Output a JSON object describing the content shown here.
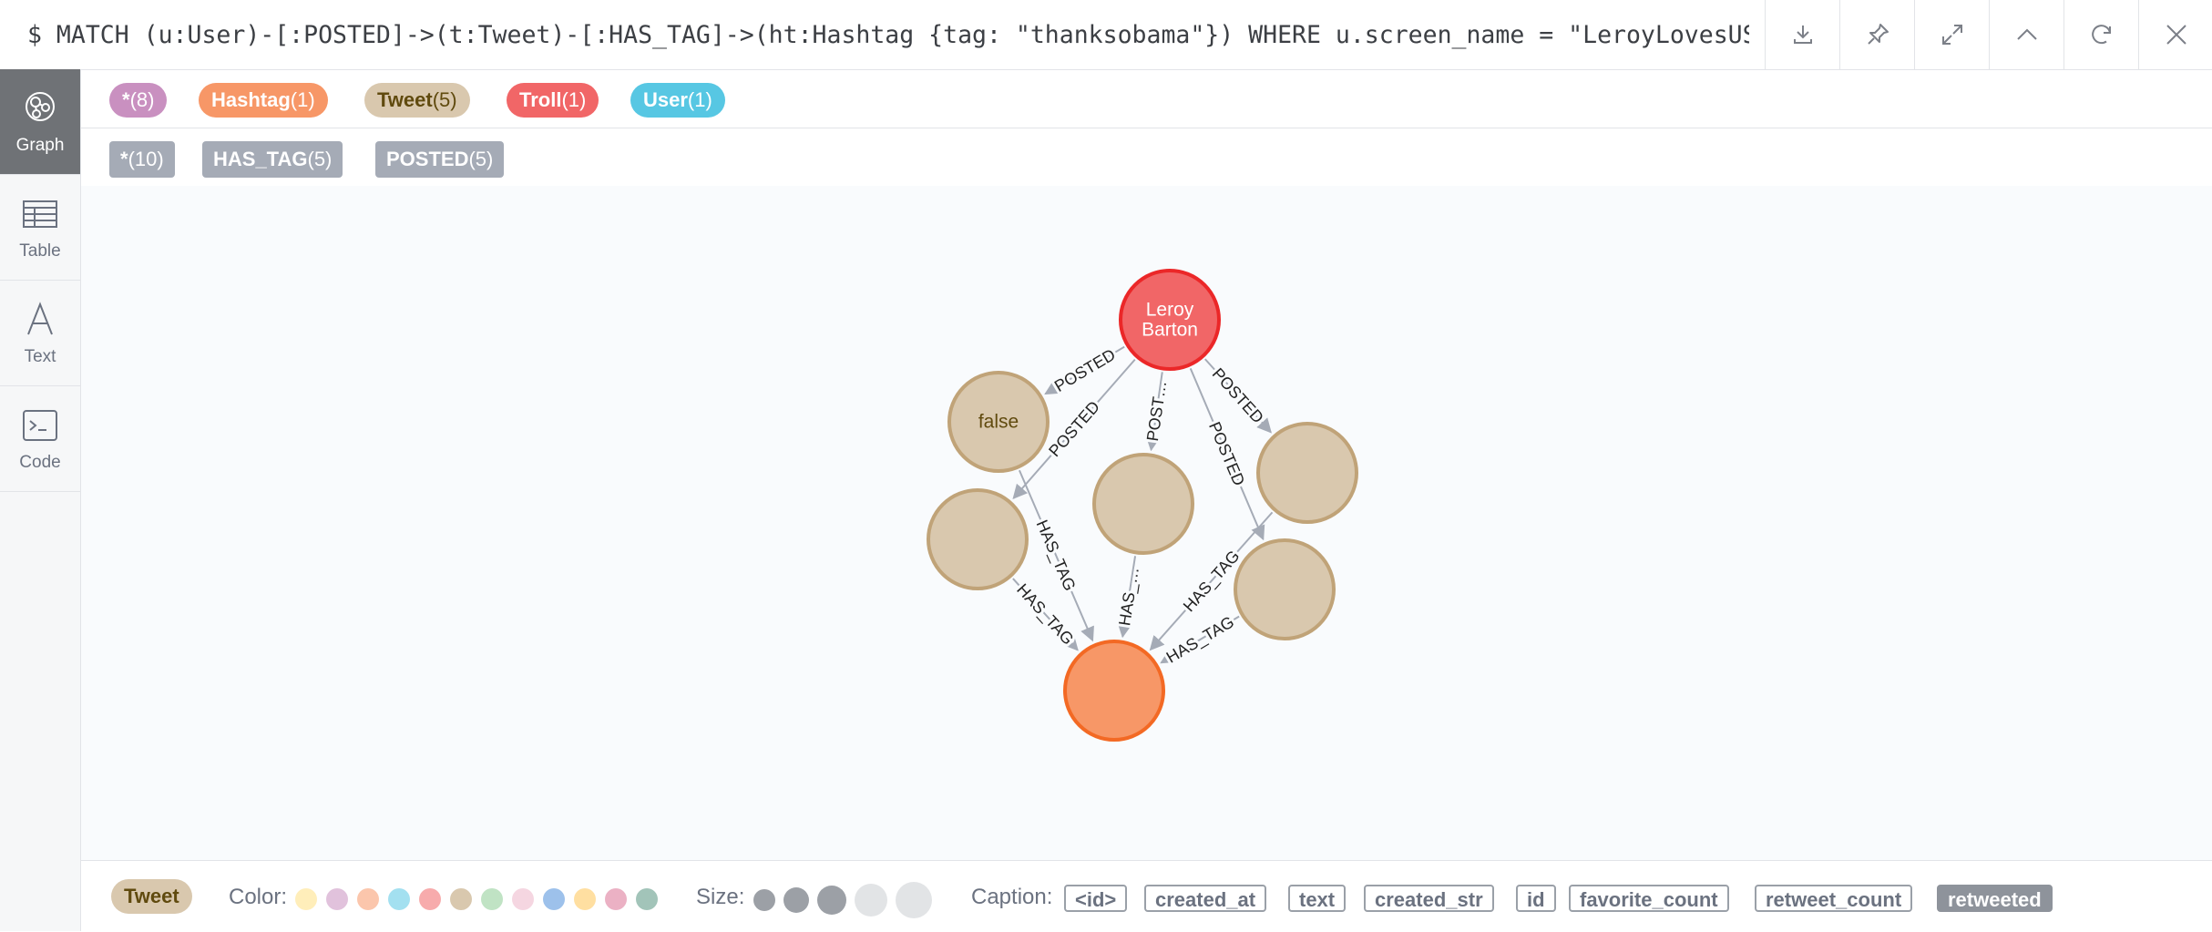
{
  "query": {
    "text": "$ MATCH (u:User)-[:POSTED]->(t:Tweet)-[:HAS_TAG]->(ht:Hashtag {tag: \"thanksobama\"}) WHERE u.screen_name = \"LeroyLovesUSA…"
  },
  "toolbar": {
    "icons": [
      "download-icon",
      "pin-icon",
      "expand-icon",
      "collapse-icon",
      "rerun-icon",
      "close-icon"
    ]
  },
  "sidebar": {
    "items": [
      {
        "label": "Graph",
        "icon": "graph-icon",
        "active": true
      },
      {
        "label": "Table",
        "icon": "table-icon",
        "active": false
      },
      {
        "label": "Text",
        "icon": "text-icon",
        "active": false
      },
      {
        "label": "Code",
        "icon": "code-icon",
        "active": false
      }
    ]
  },
  "node_labels": [
    {
      "name": "*",
      "count": "(8)",
      "color": "#c990c0"
    },
    {
      "name": "Hashtag",
      "count": "(1)",
      "color": "#f79767"
    },
    {
      "name": "Tweet",
      "count": "(5)",
      "color": "#d9c8ae"
    },
    {
      "name": "Troll",
      "count": "(1)",
      "color": "#f16667"
    },
    {
      "name": "User",
      "count": "(1)",
      "color": "#57c7e3"
    }
  ],
  "relationship_types": [
    {
      "name": "*",
      "count": "(10)"
    },
    {
      "name": "HAS_TAG",
      "count": "(5)"
    },
    {
      "name": "POSTED",
      "count": "(5)"
    }
  ],
  "graph": {
    "nodes": [
      {
        "id": "leroy",
        "label": "Troll",
        "caption_lines": [
          "Leroy",
          "Barton"
        ],
        "fill": "#f16667",
        "stroke": "#eb2728",
        "text_color": "#ffffff"
      },
      {
        "id": "t1",
        "label": "Tweet",
        "caption_lines": [
          "false"
        ],
        "fill": "#d9c8ae",
        "stroke": "#c0a378",
        "text_color": "#604a0e"
      },
      {
        "id": "t2",
        "label": "Tweet",
        "caption_lines": [],
        "fill": "#d9c8ae",
        "stroke": "#c0a378",
        "text_color": "#604a0e"
      },
      {
        "id": "t3",
        "label": "Tweet",
        "caption_lines": [],
        "fill": "#d9c8ae",
        "stroke": "#c0a378",
        "text_color": "#604a0e"
      },
      {
        "id": "t4",
        "label": "Tweet",
        "caption_lines": [],
        "fill": "#d9c8ae",
        "stroke": "#c0a378",
        "text_color": "#604a0e"
      },
      {
        "id": "t5",
        "label": "Tweet",
        "caption_lines": [],
        "fill": "#d9c8ae",
        "stroke": "#c0a378",
        "text_color": "#604a0e"
      },
      {
        "id": "hashtag",
        "label": "Hashtag",
        "caption_lines": [],
        "fill": "#f79767",
        "stroke": "#f36924",
        "text_color": "#ffffff"
      }
    ],
    "relationships": [
      {
        "from": "leroy",
        "to": "t1",
        "type": "POSTED",
        "caption": "POSTED"
      },
      {
        "from": "leroy",
        "to": "t2",
        "type": "POSTED",
        "caption": "POSTED"
      },
      {
        "from": "leroy",
        "to": "t3",
        "type": "POSTED",
        "caption": "POST…"
      },
      {
        "from": "leroy",
        "to": "t4",
        "type": "POSTED",
        "caption": "POSTED"
      },
      {
        "from": "leroy",
        "to": "t5",
        "type": "POSTED",
        "caption": "POSTED"
      },
      {
        "from": "t1",
        "to": "hashtag",
        "type": "HAS_TAG",
        "caption": "HAS_TAG"
      },
      {
        "from": "t2",
        "to": "hashtag",
        "type": "HAS_TAG",
        "caption": "HAS_TAG"
      },
      {
        "from": "t3",
        "to": "hashtag",
        "type": "HAS_TAG",
        "caption": "HAS_…"
      },
      {
        "from": "t5",
        "to": "hashtag",
        "type": "HAS_TAG",
        "caption": "HAS_TAG"
      },
      {
        "from": "t4",
        "to": "hashtag",
        "type": "HAS_TAG",
        "caption": "HAS_TAG"
      }
    ]
  },
  "style_bar": {
    "selected_label": "Tweet",
    "selected_color": "#d9c8ae",
    "color_label": "Color:",
    "colors": [
      "#ffe081",
      "#c990c0",
      "#f79767",
      "#57c7e3",
      "#f16667",
      "#d9c8ae",
      "#8dcc93",
      "#ecb5c9",
      "#4c8eda",
      "#ffc454",
      "#da7194",
      "#569480"
    ],
    "size_label": "Size:",
    "caption_label": "Caption:",
    "captions": [
      {
        "text": "<id>",
        "selected": false
      },
      {
        "text": "created_at",
        "selected": false
      },
      {
        "text": "text",
        "selected": false
      },
      {
        "text": "created_str",
        "selected": false
      },
      {
        "text": "id",
        "selected": false
      },
      {
        "text": "favorite_count",
        "selected": false
      },
      {
        "text": "retweet_count",
        "selected": false
      },
      {
        "text": "retweeted",
        "selected": true
      }
    ]
  }
}
